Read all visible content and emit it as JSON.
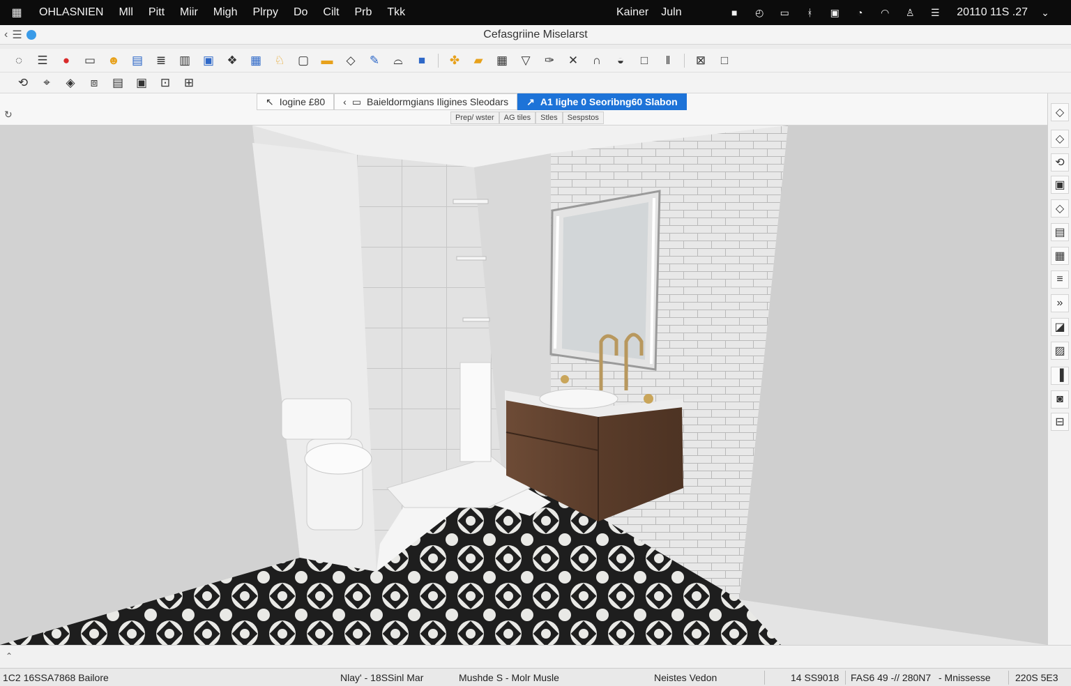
{
  "menubar": {
    "app_name": "OHLASNIEN",
    "menus": [
      "Mll",
      "Pitt",
      "Miir",
      "Migh",
      "Plrpy",
      "Do",
      "Cilt",
      "Prb",
      "Tkk"
    ],
    "user": [
      "Kainer",
      "Juln"
    ],
    "clock": "20110 11S .27"
  },
  "window": {
    "title": "Cefasgriine Miselarst"
  },
  "view_tabs": [
    {
      "label": "Iogine £80"
    },
    {
      "label": "Baieldormgians Iligines Sleodars"
    },
    {
      "label": "A1 Iighe 0 Seoribng60 Slabon"
    }
  ],
  "sub_tabs": [
    "Prep/ wster",
    "AG tiles",
    "Stles",
    "Sespstos"
  ],
  "statusbar": {
    "left": "1C2  16SSA7868 Bailore",
    "mid1": "Nlay' - 18SSinl Mar",
    "mid2": "Mushde S - Molr Musle",
    "mid3": "Neistes Vedon",
    "r1": "14 SS9018",
    "r2": "FAS6 49 -// 280N7",
    "r3": "- Mnissesse",
    "r4": "220S 5E3"
  },
  "icons": {
    "toolbar1": [
      "circle-icon",
      "list-icon",
      "record-icon",
      "image-icon",
      "smile-icon",
      "layer-icon",
      "stack-icon",
      "doc-icon",
      "blue-image-icon",
      "pattern-icon",
      "blue-box-icon",
      "person-icon",
      "panel-icon",
      "bus-icon",
      "diamond-icon",
      "brush-icon",
      "bucket-icon",
      "blue-square-icon",
      "fan-icon",
      "folder-icon",
      "grid-icon",
      "triangle-icon",
      "pen-icon",
      "cross-icon",
      "arch-icon",
      "lasso-icon",
      "square-icon",
      "pause-icon",
      "pic-icon",
      "frame-icon"
    ],
    "toolbar2": [
      "rotate-icon",
      "tag-icon",
      "paint-icon",
      "cube-icon",
      "film-icon",
      "gallery-icon",
      "tile-icon",
      "scene-icon"
    ],
    "palette": [
      "diamond-icon",
      "diamond-small-icon",
      "rotate-icon",
      "window-icon",
      "diamond-outline-icon",
      "camera-icon",
      "grid-icon",
      "lines-icon",
      "chevron-icon",
      "chart-icon",
      "image-icon",
      "book-icon",
      "tv-icon",
      "minus-icon"
    ]
  },
  "colors": {
    "accent": "#1d73d8",
    "menubar": "#0c0c0c"
  }
}
